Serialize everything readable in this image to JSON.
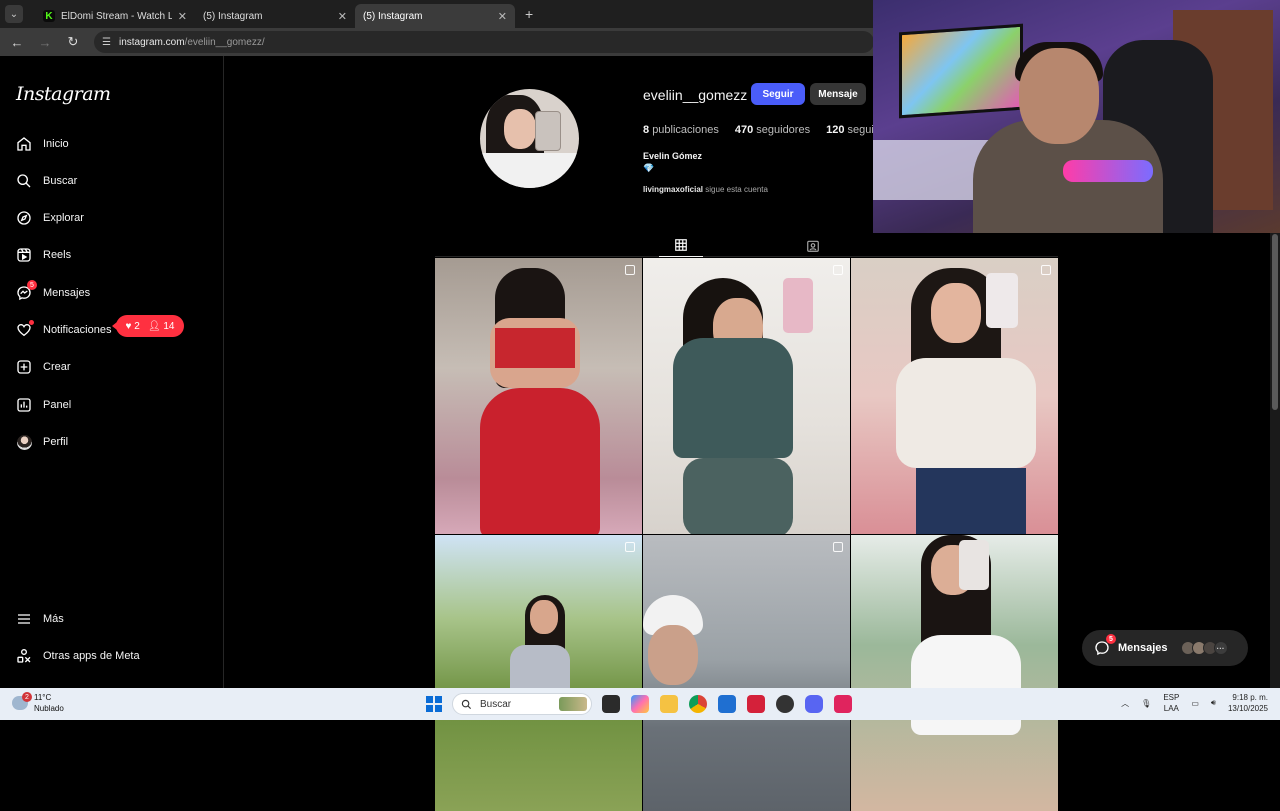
{
  "browser": {
    "tabs": [
      {
        "title": "ElDomi Stream - Watch Live on",
        "icon": "kick-icon",
        "active": false
      },
      {
        "title": "(5) Instagram",
        "icon": "instagram-icon",
        "active": false
      },
      {
        "title": "(5) Instagram",
        "icon": "instagram-icon",
        "active": true
      }
    ],
    "new_tab": "+",
    "url_host": "instagram.com",
    "url_path": "/eveliin__gomezz/"
  },
  "sidebar": {
    "logo": "Instagram",
    "items": [
      {
        "label": "Inicio",
        "icon": "home-icon"
      },
      {
        "label": "Buscar",
        "icon": "search-icon"
      },
      {
        "label": "Explorar",
        "icon": "compass-icon"
      },
      {
        "label": "Reels",
        "icon": "reels-icon"
      },
      {
        "label": "Mensajes",
        "icon": "messenger-icon",
        "badge": "5"
      },
      {
        "label": "Notificaciones",
        "icon": "heart-icon"
      },
      {
        "label": "Crear",
        "icon": "plus-square-icon"
      },
      {
        "label": "Panel",
        "icon": "chart-icon"
      },
      {
        "label": "Perfil",
        "icon": "avatar"
      }
    ],
    "bottom": [
      {
        "label": "Más",
        "icon": "menu-icon"
      },
      {
        "label": "Otras apps de Meta",
        "icon": "meta-apps-icon"
      }
    ],
    "notif_popup": {
      "likes": "2",
      "followers": "14"
    }
  },
  "profile": {
    "username": "eveliin__gomezz",
    "follow_label": "Seguir",
    "message_label": "Mensaje",
    "posts_count": "8",
    "posts_label": "publicaciones",
    "followers_count": "470",
    "followers_label": "seguidores",
    "following_count": "120",
    "following_label": "seguidos",
    "full_name": "Evelin Gómez",
    "bio_emoji": "💎",
    "followed_by_user": "livingmaxoficial",
    "followed_by_text": "sigue esta cuenta"
  },
  "posts": [
    {
      "multi": true
    },
    {
      "multi": true
    },
    {
      "multi": true
    },
    {
      "multi": true
    },
    {
      "multi": true
    },
    {
      "multi": false
    }
  ],
  "messages_float": {
    "label": "Mensajes",
    "badge": "5",
    "more": "···"
  },
  "taskbar": {
    "weather_temp": "11°C",
    "weather_desc": "Nublado",
    "weather_badge": "2",
    "search_label": "Buscar",
    "lang_top": "ESP",
    "lang_bottom": "LAA",
    "time": "9:18 p. m.",
    "date": "13/10/2025"
  },
  "colors": {
    "follow_button": "#4a5df9",
    "notification_red": "#ff3040",
    "background": "#000000"
  }
}
